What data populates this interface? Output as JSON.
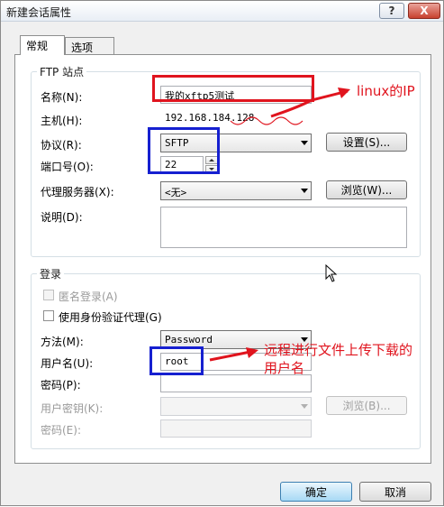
{
  "window": {
    "title": "新建会话属性",
    "help_label": "?",
    "close_label": "X"
  },
  "tabs": [
    {
      "label": "常规",
      "active": true
    },
    {
      "label": "选项",
      "active": false
    }
  ],
  "ftp_group": {
    "title": "FTP 站点",
    "name_label": "名称(N):",
    "name_value": "我的xftp5测试",
    "host_label": "主机(H):",
    "host_value": "192.168.184.128",
    "protocol_label": "协议(R):",
    "protocol_value": "SFTP",
    "settings_button": "设置(S)...",
    "port_label": "端口号(O):",
    "port_value": "22",
    "proxy_label": "代理服务器(X):",
    "proxy_value": "<无>",
    "browse_button": "浏览(W)...",
    "desc_label": "说明(D):",
    "desc_value": ""
  },
  "login_group": {
    "title": "登录",
    "anonymous_label": "匿名登录(A)",
    "agent_label": "使用身份验证代理(G)",
    "method_label": "方法(M):",
    "method_value": "Password",
    "username_label": "用户名(U):",
    "username_value": "root",
    "password_label": "密码(P):",
    "password_value": "",
    "userkey_label": "用户密钥(K):",
    "userkey_value": "",
    "browse_button": "浏览(B)...",
    "passphrase_label": "密码(E):",
    "passphrase_value": ""
  },
  "footer": {
    "ok_button": "确定",
    "cancel_button": "取消"
  },
  "annotations": {
    "linux_ip": "linux的IP",
    "remote_user_line1": "远程进行文件上传下载的",
    "remote_user_line2": "用户名"
  },
  "colors": {
    "annotation_red": "#e0141e",
    "annotation_blue": "#1620d0"
  }
}
